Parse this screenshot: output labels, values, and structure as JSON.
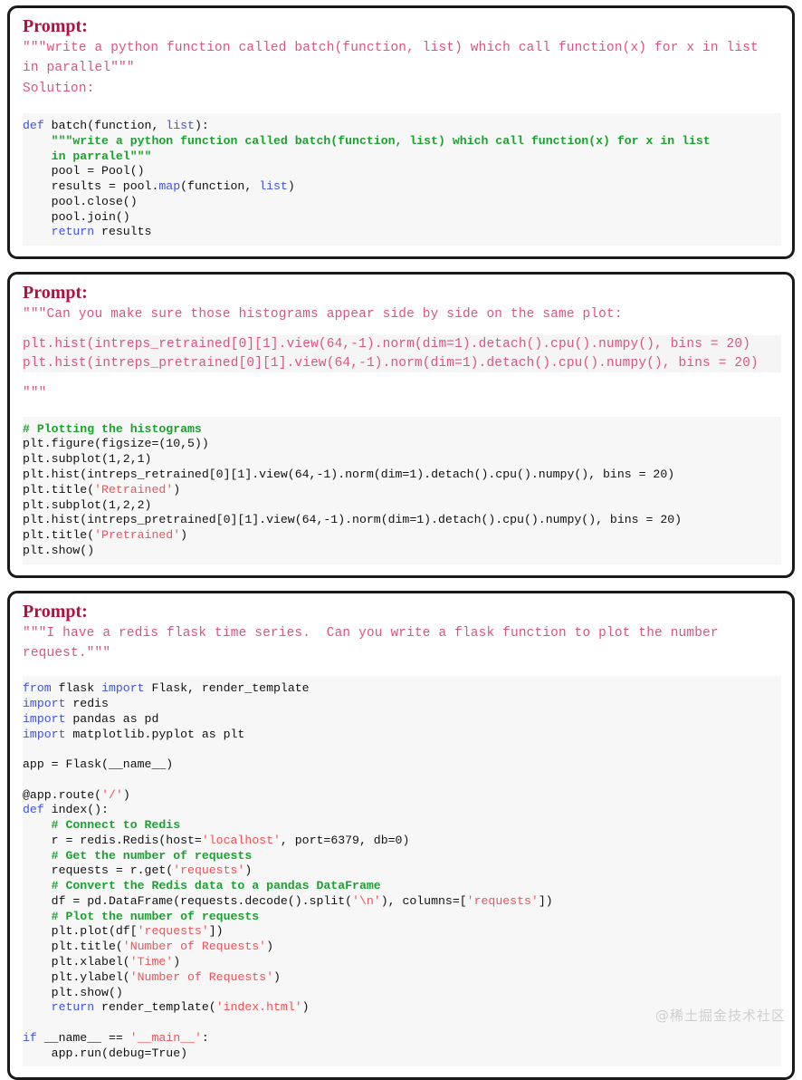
{
  "blocks": [
    {
      "label": "Prompt:",
      "prompt": "\"\"\"write a python function called batch(function, list) which call function(x) for x in list in parallel\"\"\"\nSolution:",
      "code_lines": [
        [
          {
            "t": "def ",
            "c": "kw"
          },
          {
            "t": "batch(function, ",
            "c": ""
          },
          {
            "t": "list",
            "c": "kw"
          },
          {
            "t": "):",
            "c": ""
          }
        ],
        [
          {
            "t": "    \"\"\"write a python function called batch(function, list) which call function(x) for x in list",
            "c": "doc"
          }
        ],
        [
          {
            "t": "    in parralel\"\"\"",
            "c": "doc"
          }
        ],
        [
          {
            "t": "    pool = Pool()",
            "c": ""
          }
        ],
        [
          {
            "t": "    results = pool.",
            "c": ""
          },
          {
            "t": "map",
            "c": "kw"
          },
          {
            "t": "(function, ",
            "c": ""
          },
          {
            "t": "list",
            "c": "kw"
          },
          {
            "t": ")",
            "c": ""
          }
        ],
        [
          {
            "t": "    pool.close()",
            "c": ""
          }
        ],
        [
          {
            "t": "    pool.join()",
            "c": ""
          }
        ],
        [
          {
            "t": "    ",
            "c": ""
          },
          {
            "t": "return",
            "c": "kw"
          },
          {
            "t": " results",
            "c": ""
          }
        ]
      ]
    },
    {
      "label": "Prompt:",
      "prompt_head": "\"\"\"Can you make sure those histograms appear side by side on the same plot:",
      "prompt_hl": "plt.hist(intreps_retrained[0][1].view(64,-1).norm(dim=1).detach().cpu().numpy(), bins = 20)\nplt.hist(intreps_pretrained[0][1].view(64,-1).norm(dim=1).detach().cpu().numpy(), bins = 20)",
      "prompt_tail": "\"\"\"",
      "code_lines": [
        [
          {
            "t": "# Plotting the histograms",
            "c": "cmt"
          }
        ],
        [
          {
            "t": "plt.figure(figsize=(10,5))",
            "c": ""
          }
        ],
        [
          {
            "t": "plt.subplot(1,2,1)",
            "c": ""
          }
        ],
        [
          {
            "t": "plt.hist(intreps_retrained[0][1].view(64,-1).norm(dim=1).detach().cpu().numpy(), bins = 20)",
            "c": ""
          }
        ],
        [
          {
            "t": "plt.title(",
            "c": ""
          },
          {
            "t": "'Retrained'",
            "c": "str"
          },
          {
            "t": ")",
            "c": ""
          }
        ],
        [
          {
            "t": "plt.subplot(1,2,2)",
            "c": ""
          }
        ],
        [
          {
            "t": "plt.hist(intreps_pretrained[0][1].view(64,-1).norm(dim=1).detach().cpu().numpy(), bins = 20)",
            "c": ""
          }
        ],
        [
          {
            "t": "plt.title(",
            "c": ""
          },
          {
            "t": "'Pretrained'",
            "c": "str"
          },
          {
            "t": ")",
            "c": ""
          }
        ],
        [
          {
            "t": "plt.show()",
            "c": ""
          }
        ]
      ]
    },
    {
      "label": "Prompt:",
      "prompt": "\"\"\"I have a redis flask time series.  Can you write a flask function to plot the number request.\"\"\"",
      "code_lines": [
        [
          {
            "t": "from",
            "c": "kw"
          },
          {
            "t": " flask ",
            "c": ""
          },
          {
            "t": "import",
            "c": "kw"
          },
          {
            "t": " Flask, render_template",
            "c": ""
          }
        ],
        [
          {
            "t": "import",
            "c": "kw"
          },
          {
            "t": " redis",
            "c": ""
          }
        ],
        [
          {
            "t": "import",
            "c": "kw"
          },
          {
            "t": " pandas as pd",
            "c": ""
          }
        ],
        [
          {
            "t": "import",
            "c": "kw"
          },
          {
            "t": " matplotlib.pyplot as plt",
            "c": ""
          }
        ],
        [
          {
            "t": "",
            "c": ""
          }
        ],
        [
          {
            "t": "app = Flask(__name__)",
            "c": ""
          }
        ],
        [
          {
            "t": "",
            "c": ""
          }
        ],
        [
          {
            "t": "@app.route(",
            "c": ""
          },
          {
            "t": "'/'",
            "c": "str"
          },
          {
            "t": ")",
            "c": ""
          }
        ],
        [
          {
            "t": "def",
            "c": "kw"
          },
          {
            "t": " index():",
            "c": ""
          }
        ],
        [
          {
            "t": "    # Connect to Redis",
            "c": "cmt"
          }
        ],
        [
          {
            "t": "    r = redis.Redis(host=",
            "c": ""
          },
          {
            "t": "'localhost'",
            "c": "str"
          },
          {
            "t": ", port=6379, db=0)",
            "c": ""
          }
        ],
        [
          {
            "t": "    # Get the number of requests",
            "c": "cmt"
          }
        ],
        [
          {
            "t": "    requests = r.get(",
            "c": ""
          },
          {
            "t": "'requests'",
            "c": "str"
          },
          {
            "t": ")",
            "c": ""
          }
        ],
        [
          {
            "t": "    # Convert the Redis data to a pandas DataFrame",
            "c": "cmt"
          }
        ],
        [
          {
            "t": "    df = pd.DataFrame(requests.decode().split(",
            "c": ""
          },
          {
            "t": "'\\n'",
            "c": "str"
          },
          {
            "t": "), columns=[",
            "c": ""
          },
          {
            "t": "'requests'",
            "c": "str"
          },
          {
            "t": "])",
            "c": ""
          }
        ],
        [
          {
            "t": "    # Plot the number of requests",
            "c": "cmt"
          }
        ],
        [
          {
            "t": "    plt.plot(df[",
            "c": ""
          },
          {
            "t": "'requests'",
            "c": "str"
          },
          {
            "t": "])",
            "c": ""
          }
        ],
        [
          {
            "t": "    plt.title(",
            "c": ""
          },
          {
            "t": "'Number of Requests'",
            "c": "str"
          },
          {
            "t": ")",
            "c": ""
          }
        ],
        [
          {
            "t": "    plt.xlabel(",
            "c": ""
          },
          {
            "t": "'Time'",
            "c": "str"
          },
          {
            "t": ")",
            "c": ""
          }
        ],
        [
          {
            "t": "    plt.ylabel(",
            "c": ""
          },
          {
            "t": "'Number of Requests'",
            "c": "str"
          },
          {
            "t": ")",
            "c": ""
          }
        ],
        [
          {
            "t": "    plt.show()",
            "c": ""
          }
        ],
        [
          {
            "t": "    ",
            "c": ""
          },
          {
            "t": "return",
            "c": "kw"
          },
          {
            "t": " render_template(",
            "c": ""
          },
          {
            "t": "'index.html'",
            "c": "str"
          },
          {
            "t": ")",
            "c": ""
          }
        ],
        [
          {
            "t": "",
            "c": ""
          }
        ],
        [
          {
            "t": "if",
            "c": "kw"
          },
          {
            "t": " __name__ == ",
            "c": ""
          },
          {
            "t": "'__main__'",
            "c": "str"
          },
          {
            "t": ":",
            "c": ""
          }
        ],
        [
          {
            "t": "    app.run(debug=True)",
            "c": ""
          }
        ]
      ]
    }
  ],
  "watermark": "@稀土掘金技术社区",
  "colors": {
    "prompt_label": "#b0113f",
    "prompt_text": "#e0527e",
    "keyword": "#3f51e8",
    "string": "#fa4d56",
    "comment": "#1aa22e",
    "code_bg": "#f7f7f7",
    "border": "#1a1a1a"
  }
}
